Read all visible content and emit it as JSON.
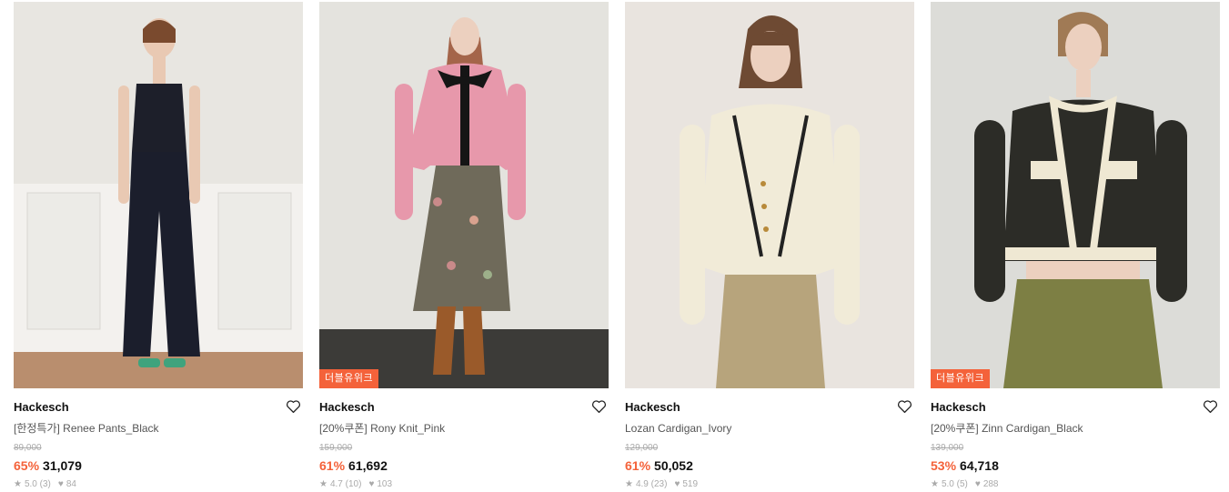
{
  "products": [
    {
      "brand": "Hackesch",
      "name": "[한정특가] Renee Pants_Black",
      "original_price": "89,000",
      "discount": "65%",
      "price": "31,079",
      "rating": "5.0 (3)",
      "likes": "84",
      "badge": "",
      "image_desc": "model in black sleeveless top and wide black pants",
      "colors": {
        "bg": "#e8e6e1",
        "top": "#1d1f2a",
        "bottom": "#1b1e2c",
        "floor": "#b98e6e"
      }
    },
    {
      "brand": "Hackesch",
      "name": "[20%쿠폰] Rony Knit_Pink",
      "original_price": "159,000",
      "discount": "61%",
      "price": "61,692",
      "rating": "4.7 (10)",
      "likes": "103",
      "badge": "더블유위크",
      "image_desc": "model in pink knit with black ribbon and floral skirt",
      "colors": {
        "bg": "#e4e3de",
        "top": "#e798ab",
        "bottom": "#6f6a5a",
        "floor": "#3c3b38"
      }
    },
    {
      "brand": "Hackesch",
      "name": "Lozan Cardigan_Ivory",
      "original_price": "129,000",
      "discount": "61%",
      "price": "50,052",
      "rating": "4.9 (23)",
      "likes": "519",
      "badge": "",
      "image_desc": "model in ivory cardigan with black trim and khaki pants",
      "colors": {
        "bg": "#e9e4df",
        "top": "#f1ebd8",
        "bottom": "#b7a47c",
        "floor": "#e9e4df"
      }
    },
    {
      "brand": "Hackesch",
      "name": "[20%쿠폰] Zinn Cardigan_Black",
      "original_price": "139,000",
      "discount": "53%",
      "price": "64,718",
      "rating": "5.0 (5)",
      "likes": "288",
      "badge": "더블유위크",
      "image_desc": "model in black cardigan with cream trim and olive cargo pants",
      "colors": {
        "bg": "#dcdcd8",
        "top": "#2c2c27",
        "bottom": "#7d7f44",
        "floor": "#dcdcd8"
      }
    }
  ]
}
